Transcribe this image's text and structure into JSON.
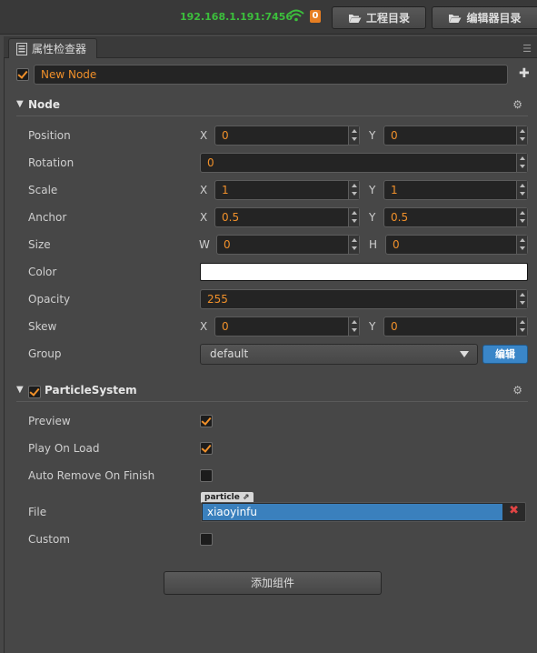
{
  "topbar": {
    "ip": "192.168.1.191:7456",
    "badge_count": "0",
    "project_btn": "工程目录",
    "editor_btn": "编辑器目录"
  },
  "panel": {
    "tab_title": "属性检查器"
  },
  "node_header": {
    "enabled": true,
    "name": "New Node"
  },
  "node_section": {
    "title": "Node",
    "labels": {
      "position": "Position",
      "rotation": "Rotation",
      "scale": "Scale",
      "anchor": "Anchor",
      "size": "Size",
      "color": "Color",
      "opacity": "Opacity",
      "skew": "Skew",
      "group": "Group"
    },
    "axis": {
      "x": "X",
      "y": "Y",
      "w": "W",
      "h": "H"
    },
    "position": {
      "x": "0",
      "y": "0"
    },
    "rotation": "0",
    "scale": {
      "x": "1",
      "y": "1"
    },
    "anchor": {
      "x": "0.5",
      "y": "0.5"
    },
    "size": {
      "w": "0",
      "h": "0"
    },
    "color": "#ffffff",
    "opacity": "255",
    "skew": {
      "x": "0",
      "y": "0"
    },
    "group": "default",
    "group_edit_btn": "编辑"
  },
  "particle_section": {
    "title": "ParticleSystem",
    "enabled": true,
    "labels": {
      "preview": "Preview",
      "play_on_load": "Play On Load",
      "auto_remove": "Auto Remove On Finish",
      "file": "File",
      "custom": "Custom"
    },
    "preview": true,
    "play_on_load": true,
    "auto_remove": false,
    "custom": false,
    "file_asset_type": "particle",
    "file_value": "xiaoyinfu"
  },
  "add_component_btn": "添加组件",
  "colors": {
    "accent": "#f0902a",
    "asset_blue": "#3a80bd",
    "edit_blue": "#3a86c8",
    "ip_green": "#3cbf3c"
  }
}
